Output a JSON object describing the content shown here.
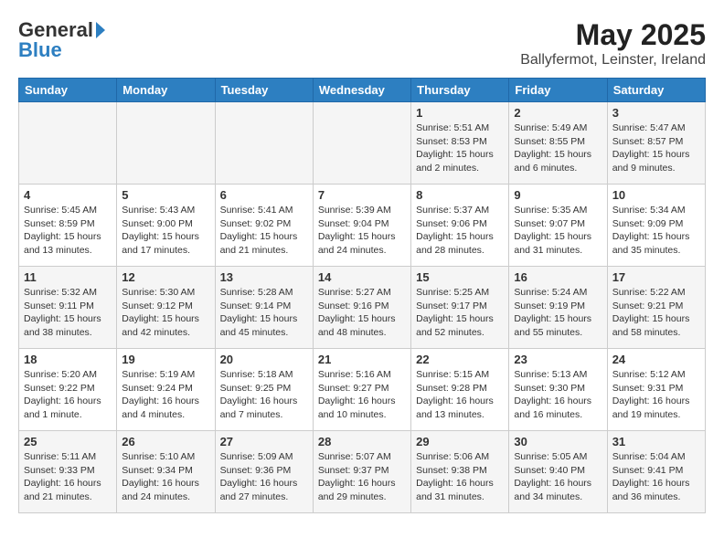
{
  "header": {
    "logo_general": "General",
    "logo_blue": "Blue",
    "month_title": "May 2025",
    "location": "Ballyfermot, Leinster, Ireland"
  },
  "weekdays": [
    "Sunday",
    "Monday",
    "Tuesday",
    "Wednesday",
    "Thursday",
    "Friday",
    "Saturday"
  ],
  "weeks": [
    [
      {
        "day": "",
        "info": ""
      },
      {
        "day": "",
        "info": ""
      },
      {
        "day": "",
        "info": ""
      },
      {
        "day": "",
        "info": ""
      },
      {
        "day": "1",
        "info": "Sunrise: 5:51 AM\nSunset: 8:53 PM\nDaylight: 15 hours\nand 2 minutes."
      },
      {
        "day": "2",
        "info": "Sunrise: 5:49 AM\nSunset: 8:55 PM\nDaylight: 15 hours\nand 6 minutes."
      },
      {
        "day": "3",
        "info": "Sunrise: 5:47 AM\nSunset: 8:57 PM\nDaylight: 15 hours\nand 9 minutes."
      }
    ],
    [
      {
        "day": "4",
        "info": "Sunrise: 5:45 AM\nSunset: 8:59 PM\nDaylight: 15 hours\nand 13 minutes."
      },
      {
        "day": "5",
        "info": "Sunrise: 5:43 AM\nSunset: 9:00 PM\nDaylight: 15 hours\nand 17 minutes."
      },
      {
        "day": "6",
        "info": "Sunrise: 5:41 AM\nSunset: 9:02 PM\nDaylight: 15 hours\nand 21 minutes."
      },
      {
        "day": "7",
        "info": "Sunrise: 5:39 AM\nSunset: 9:04 PM\nDaylight: 15 hours\nand 24 minutes."
      },
      {
        "day": "8",
        "info": "Sunrise: 5:37 AM\nSunset: 9:06 PM\nDaylight: 15 hours\nand 28 minutes."
      },
      {
        "day": "9",
        "info": "Sunrise: 5:35 AM\nSunset: 9:07 PM\nDaylight: 15 hours\nand 31 minutes."
      },
      {
        "day": "10",
        "info": "Sunrise: 5:34 AM\nSunset: 9:09 PM\nDaylight: 15 hours\nand 35 minutes."
      }
    ],
    [
      {
        "day": "11",
        "info": "Sunrise: 5:32 AM\nSunset: 9:11 PM\nDaylight: 15 hours\nand 38 minutes."
      },
      {
        "day": "12",
        "info": "Sunrise: 5:30 AM\nSunset: 9:12 PM\nDaylight: 15 hours\nand 42 minutes."
      },
      {
        "day": "13",
        "info": "Sunrise: 5:28 AM\nSunset: 9:14 PM\nDaylight: 15 hours\nand 45 minutes."
      },
      {
        "day": "14",
        "info": "Sunrise: 5:27 AM\nSunset: 9:16 PM\nDaylight: 15 hours\nand 48 minutes."
      },
      {
        "day": "15",
        "info": "Sunrise: 5:25 AM\nSunset: 9:17 PM\nDaylight: 15 hours\nand 52 minutes."
      },
      {
        "day": "16",
        "info": "Sunrise: 5:24 AM\nSunset: 9:19 PM\nDaylight: 15 hours\nand 55 minutes."
      },
      {
        "day": "17",
        "info": "Sunrise: 5:22 AM\nSunset: 9:21 PM\nDaylight: 15 hours\nand 58 minutes."
      }
    ],
    [
      {
        "day": "18",
        "info": "Sunrise: 5:20 AM\nSunset: 9:22 PM\nDaylight: 16 hours\nand 1 minute."
      },
      {
        "day": "19",
        "info": "Sunrise: 5:19 AM\nSunset: 9:24 PM\nDaylight: 16 hours\nand 4 minutes."
      },
      {
        "day": "20",
        "info": "Sunrise: 5:18 AM\nSunset: 9:25 PM\nDaylight: 16 hours\nand 7 minutes."
      },
      {
        "day": "21",
        "info": "Sunrise: 5:16 AM\nSunset: 9:27 PM\nDaylight: 16 hours\nand 10 minutes."
      },
      {
        "day": "22",
        "info": "Sunrise: 5:15 AM\nSunset: 9:28 PM\nDaylight: 16 hours\nand 13 minutes."
      },
      {
        "day": "23",
        "info": "Sunrise: 5:13 AM\nSunset: 9:30 PM\nDaylight: 16 hours\nand 16 minutes."
      },
      {
        "day": "24",
        "info": "Sunrise: 5:12 AM\nSunset: 9:31 PM\nDaylight: 16 hours\nand 19 minutes."
      }
    ],
    [
      {
        "day": "25",
        "info": "Sunrise: 5:11 AM\nSunset: 9:33 PM\nDaylight: 16 hours\nand 21 minutes."
      },
      {
        "day": "26",
        "info": "Sunrise: 5:10 AM\nSunset: 9:34 PM\nDaylight: 16 hours\nand 24 minutes."
      },
      {
        "day": "27",
        "info": "Sunrise: 5:09 AM\nSunset: 9:36 PM\nDaylight: 16 hours\nand 27 minutes."
      },
      {
        "day": "28",
        "info": "Sunrise: 5:07 AM\nSunset: 9:37 PM\nDaylight: 16 hours\nand 29 minutes."
      },
      {
        "day": "29",
        "info": "Sunrise: 5:06 AM\nSunset: 9:38 PM\nDaylight: 16 hours\nand 31 minutes."
      },
      {
        "day": "30",
        "info": "Sunrise: 5:05 AM\nSunset: 9:40 PM\nDaylight: 16 hours\nand 34 minutes."
      },
      {
        "day": "31",
        "info": "Sunrise: 5:04 AM\nSunset: 9:41 PM\nDaylight: 16 hours\nand 36 minutes."
      }
    ]
  ]
}
